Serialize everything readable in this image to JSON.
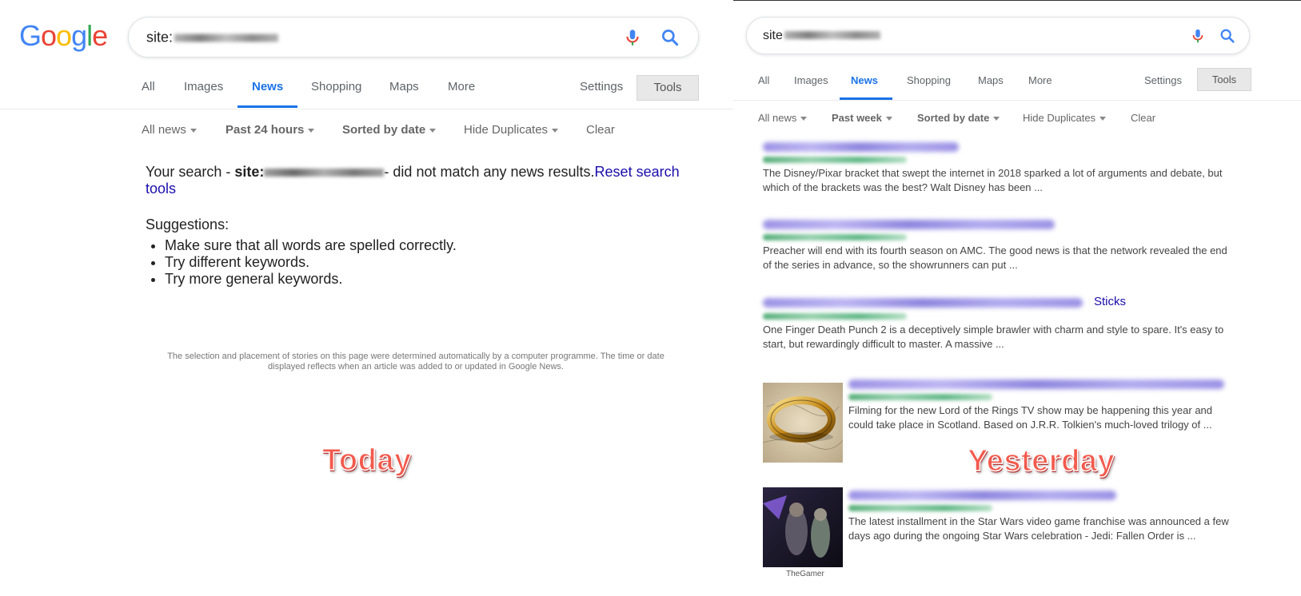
{
  "left": {
    "logo": [
      "G",
      "o",
      "o",
      "g",
      "l",
      "e"
    ],
    "logo_colors": [
      "#4285F4",
      "#EA4335",
      "#FBBC05",
      "#4285F4",
      "#34A853",
      "#EA4335"
    ],
    "query": "site:",
    "tabs": [
      "All",
      "Images",
      "News",
      "Shopping",
      "Maps",
      "More"
    ],
    "settings": "Settings",
    "tools": "Tools",
    "filters": [
      "All news",
      "Past 24 hours",
      "Sorted by date",
      "Hide Duplicates",
      "Clear"
    ],
    "message_prefix": "Your search - ",
    "message_site": "site:",
    "message_suffix": "- did not match any news results.",
    "reset_link": "Reset search tools",
    "suggestions_title": "Suggestions:",
    "suggestions": [
      "Make sure that all words are spelled correctly.",
      "Try different keywords.",
      "Try more general keywords."
    ],
    "note": "The selection and placement of stories on this page were determined automatically by a computer programme. The time or date displayed reflects when an article was added to or updated in Google News.",
    "label": "Today"
  },
  "right": {
    "query": "site",
    "tabs": [
      "All",
      "Images",
      "News",
      "Shopping",
      "Maps",
      "More"
    ],
    "settings": "Settings",
    "tools": "Tools",
    "filters": [
      "All news",
      "Past week",
      "Sorted by date",
      "Hide Duplicates",
      "Clear"
    ],
    "label": "Yesterday",
    "results": [
      {
        "snippet": "The Disney/Pixar bracket that swept the internet in 2018 sparked a lot of arguments and debate, but which of the brackets was the best? Walt Disney has been ..."
      },
      {
        "snippet": "Preacher will end with its fourth season on AMC. The good news is that the network revealed the end of the series in advance, so the showrunners can put ..."
      },
      {
        "title_tail": "Sticks",
        "snippet": "One Finger Death Punch 2 is a deceptively simple brawler with charm and style to spare. It's easy to start, but rewardingly difficult to master. A massive ..."
      },
      {
        "snippet": "Filming for the new Lord of the Rings TV show may be happening this year and could take place in Scotland. Based on J.R.R. Tolkien's much-loved trilogy of ..."
      },
      {
        "snippet": "The latest installment in the Star Wars video game franchise was announced a few days ago during the ongoing Star Wars celebration - Jedi: Fallen Order is ...",
        "source": "TheGamer"
      }
    ]
  }
}
